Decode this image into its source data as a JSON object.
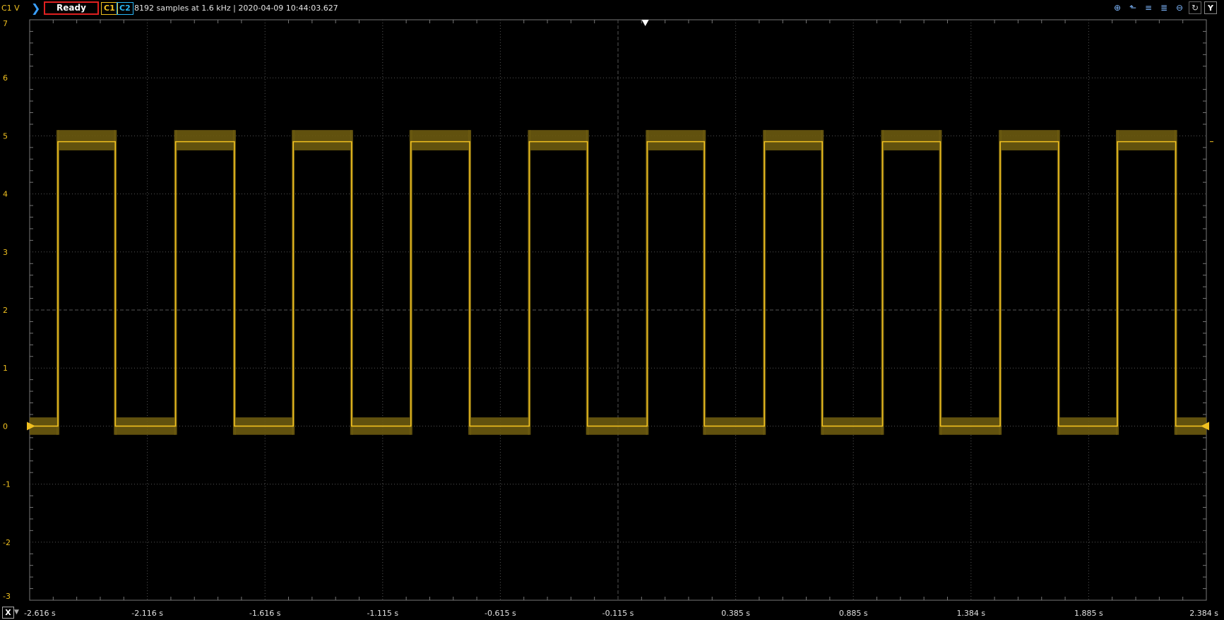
{
  "toolbar": {
    "channel_unit": "C1 V",
    "run_icon": "play-arrow-icon",
    "status": "Ready",
    "c1_label": "C1",
    "c2_label": "C2",
    "acquisition_info": "8192 samples at 1.6 kHz | 2020-04-09 10:44:03.627",
    "tools": [
      "zoom-in-icon",
      "zoom-select-icon",
      "zoom-horizontal-icon",
      "zoom-vertical-icon",
      "zoom-out-icon",
      "rotate-icon"
    ],
    "y_button": "Y",
    "x_button": "X"
  },
  "colors": {
    "trace": "#f0c020",
    "envelope": "#6b5a10",
    "grid": "#555555",
    "status_border": "#e02020",
    "c2": "#29b6f6"
  },
  "chart_data": {
    "type": "line",
    "ylim": [
      -3,
      7
    ],
    "yticks": [
      "7",
      "6",
      "5",
      "4",
      "3",
      "2",
      "1",
      "0",
      "-1",
      "-2",
      "-3"
    ],
    "xlim": [
      -2.616,
      2.384
    ],
    "xticks": [
      "-2.616 s",
      "-2.116 s",
      "-1.616 s",
      "-1.115 s",
      "-0.615 s",
      "-0.115 s",
      "0.385 s",
      "0.885 s",
      "1.384 s",
      "1.885 s",
      "2.384 s"
    ],
    "x_units": "s",
    "series": [
      {
        "high_level": 4.9,
        "low_level": 0.0,
        "envelope_high": [
          4.75,
          5.1
        ],
        "envelope_low": [
          -0.15,
          0.15
        ],
        "edges": [
          {
            "t": -2.496,
            "dir": "up"
          },
          {
            "t": -2.252,
            "dir": "down"
          },
          {
            "t": -1.996,
            "dir": "up"
          },
          {
            "t": -1.746,
            "dir": "down"
          },
          {
            "t": -1.496,
            "dir": "up"
          },
          {
            "t": -1.248,
            "dir": "down"
          },
          {
            "t": -0.996,
            "dir": "up"
          },
          {
            "t": -0.746,
            "dir": "down"
          },
          {
            "t": -0.493,
            "dir": "up"
          },
          {
            "t": -0.246,
            "dir": "down"
          },
          {
            "t": 0.008,
            "dir": "up"
          },
          {
            "t": 0.251,
            "dir": "down"
          },
          {
            "t": 0.506,
            "dir": "up"
          },
          {
            "t": 0.752,
            "dir": "down"
          },
          {
            "t": 1.008,
            "dir": "up"
          },
          {
            "t": 1.254,
            "dir": "down"
          },
          {
            "t": 1.508,
            "dir": "up"
          },
          {
            "t": 1.756,
            "dir": "down"
          },
          {
            "t": 2.006,
            "dir": "up"
          },
          {
            "t": 2.254,
            "dir": "down"
          }
        ]
      }
    ],
    "trigger_level": 0,
    "trigger_time": 0.0,
    "grid": true
  }
}
